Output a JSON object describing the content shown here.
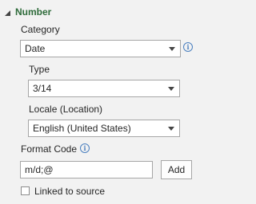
{
  "section": {
    "title": "Number"
  },
  "category": {
    "label": "Category",
    "value": "Date"
  },
  "type": {
    "label": "Type",
    "value": "3/14"
  },
  "locale": {
    "label": "Locale (Location)",
    "value": "English (United States)"
  },
  "format_code": {
    "label": "Format Code",
    "value": "m/d;@",
    "add_label": "Add"
  },
  "linked": {
    "label": "Linked to source",
    "checked": false
  },
  "icons": {
    "info": "i"
  }
}
